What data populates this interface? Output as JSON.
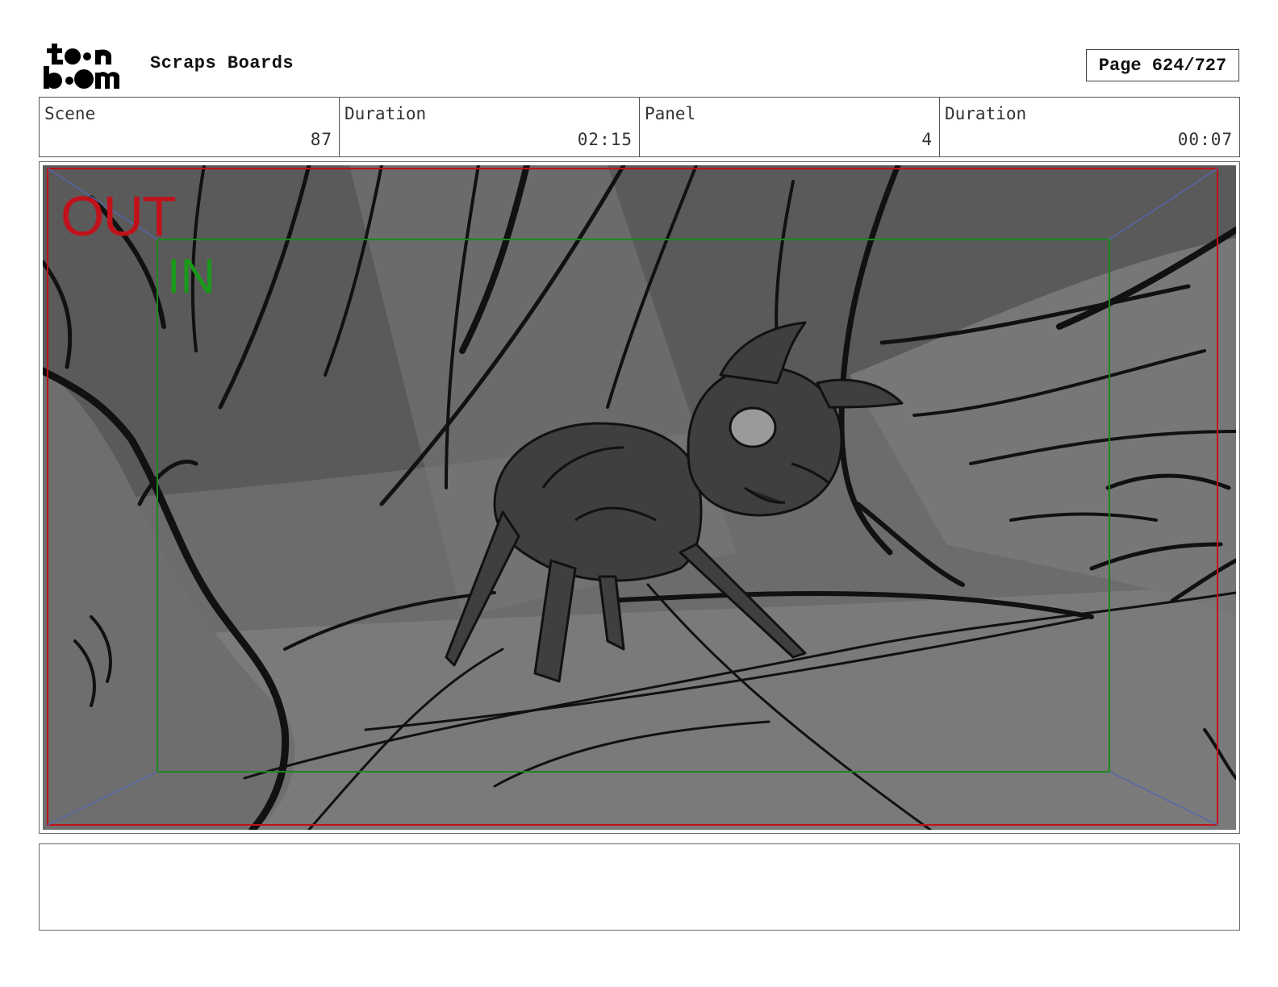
{
  "header": {
    "logo": {
      "text": "toon boom",
      "icon": "toon-boom-logo"
    },
    "title": "Scraps Boards",
    "page_label": "Page 624/727"
  },
  "info": {
    "scene_label": "Scene",
    "scene_value": "87",
    "scene_duration_label": "Duration",
    "scene_duration_value": "02:15",
    "panel_label": "Panel",
    "panel_value": "4",
    "panel_duration_label": "Duration",
    "panel_duration_value": "00:07"
  },
  "panel": {
    "out_label": "OUT",
    "in_label": "IN",
    "out_frame_color": "#c0121a",
    "in_frame_color": "#1a8a1a"
  },
  "notes": {
    "text": ""
  }
}
